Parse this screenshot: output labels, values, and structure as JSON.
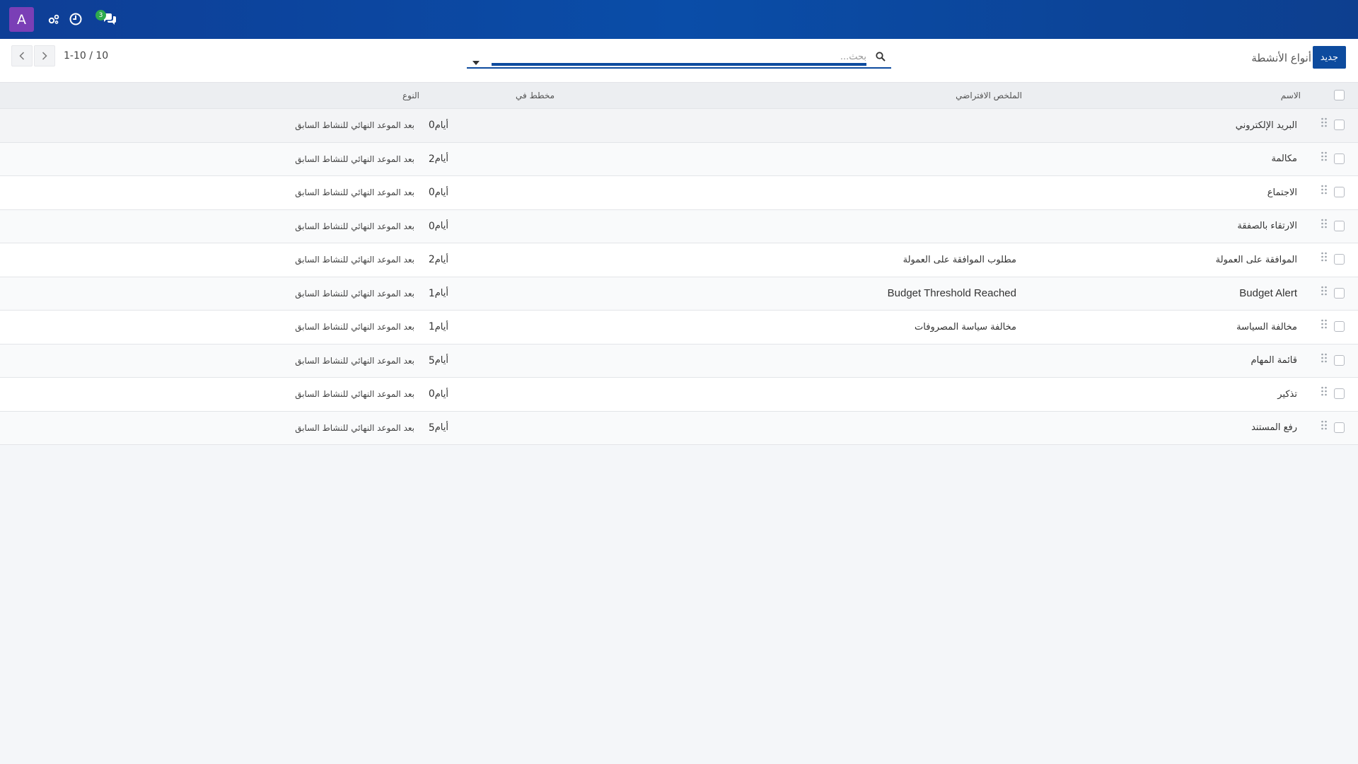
{
  "navbar": {
    "avatar_letter": "A",
    "messages_badge": "3",
    "accent": "#0d4b9e"
  },
  "control": {
    "new_button": "جديد",
    "title": "أنواع الأنشطة",
    "search_placeholder": "بحث...",
    "pager": "1-10 / 10"
  },
  "table": {
    "headers": {
      "name": "الاسم",
      "summary": "الملخص الافتراضي",
      "planned": "مخطط في",
      "type": "النوع"
    },
    "rows": [
      {
        "name": "البريد الإلكتروني",
        "summary": "",
        "days": "0",
        "unit": "أيام",
        "type": "بعد الموعد النهائي للنشاط السابق"
      },
      {
        "name": "مكالمة",
        "summary": "",
        "days": "2",
        "unit": "أيام",
        "type": "بعد الموعد النهائي للنشاط السابق"
      },
      {
        "name": "الاجتماع",
        "summary": "",
        "days": "0",
        "unit": "أيام",
        "type": "بعد الموعد النهائي للنشاط السابق"
      },
      {
        "name": "الارتقاء بالصفقة",
        "summary": "",
        "days": "0",
        "unit": "أيام",
        "type": "بعد الموعد النهائي للنشاط السابق"
      },
      {
        "name": "الموافقة على العمولة",
        "summary": "مطلوب الموافقة على العمولة",
        "days": "2",
        "unit": "أيام",
        "type": "بعد الموعد النهائي للنشاط السابق"
      },
      {
        "name": "Budget Alert",
        "summary": "Budget Threshold Reached",
        "days": "1",
        "unit": "أيام",
        "type": "بعد الموعد النهائي للنشاط السابق"
      },
      {
        "name": "مخالفة السياسة",
        "summary": "مخالفة سياسة المصروفات",
        "days": "1",
        "unit": "أيام",
        "type": "بعد الموعد النهائي للنشاط السابق"
      },
      {
        "name": "قائمة المهام",
        "summary": "",
        "days": "5",
        "unit": "أيام",
        "type": "بعد الموعد النهائي للنشاط السابق"
      },
      {
        "name": "تذكير",
        "summary": "",
        "days": "0",
        "unit": "أيام",
        "type": "بعد الموعد النهائي للنشاط السابق"
      },
      {
        "name": "رفع المستند",
        "summary": "",
        "days": "5",
        "unit": "أيام",
        "type": "بعد الموعد النهائي للنشاط السابق"
      }
    ]
  }
}
